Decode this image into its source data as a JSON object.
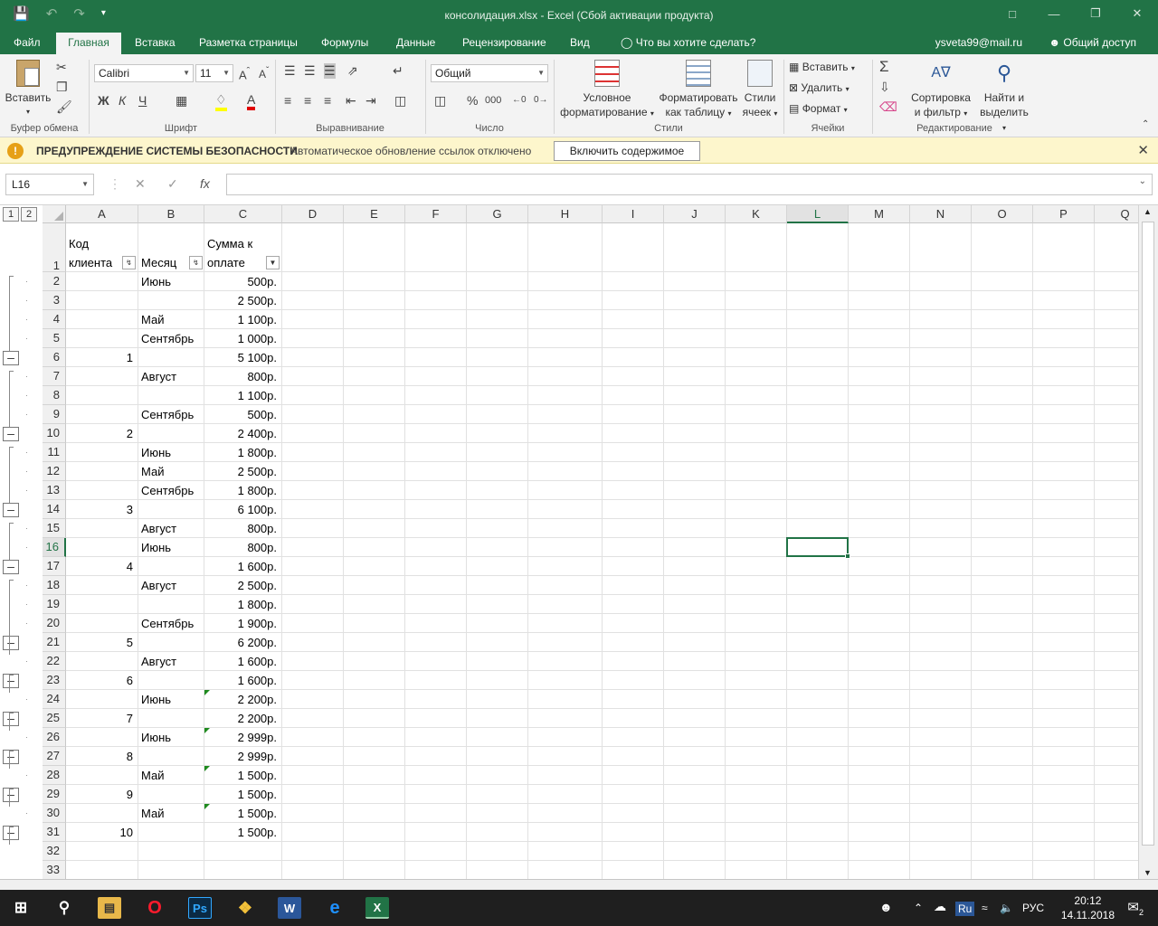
{
  "window": {
    "title": "консолидация.xlsx - Excel (Сбой активации продукта)"
  },
  "ribbon_tabs": [
    "Файл",
    "Главная",
    "Вставка",
    "Разметка страницы",
    "Формулы",
    "Данные",
    "Рецензирование",
    "Вид",
    "Что вы хотите сделать?"
  ],
  "user": {
    "email": "ysveta99@mail.ru",
    "share": "Общий доступ"
  },
  "ribbon": {
    "paste": "Вставить",
    "font_name": "Calibri",
    "font_size": "11",
    "number_format": "Общий",
    "cond_format_1": "Условное",
    "cond_format_2": "форматирование",
    "format_table_1": "Форматировать",
    "format_table_2": "как таблицу",
    "cell_styles_1": "Стили",
    "cell_styles_2": "ячеек",
    "insert": "Вставить",
    "delete": "Удалить",
    "format": "Формат",
    "sort_1": "Сортировка",
    "sort_2": "и фильтр",
    "find_1": "Найти и",
    "find_2": "выделить",
    "groups": [
      "Буфер обмена",
      "Шрифт",
      "Выравнивание",
      "Число",
      "Стили",
      "Ячейки",
      "Редактирование"
    ]
  },
  "security": {
    "title": "ПРЕДУПРЕЖДЕНИЕ СИСТЕМЫ БЕЗОПАСНОСТИ",
    "message": "Автоматическое обновление ссылок отключено",
    "button": "Включить содержимое"
  },
  "formula_bar": {
    "name_box": "L16",
    "value": ""
  },
  "columns": [
    "A",
    "B",
    "C",
    "D",
    "E",
    "F",
    "G",
    "H",
    "I",
    "J",
    "K",
    "L",
    "M",
    "N",
    "O",
    "P",
    "Q"
  ],
  "outline_levels": [
    "1",
    "2"
  ],
  "header_row": {
    "a1": "Код",
    "a2": "клиента",
    "b": "Месяц",
    "c1": "Сумма к",
    "c2": "оплате"
  },
  "rows": [
    {
      "n": "2",
      "a": "",
      "b": "Июнь",
      "c": "500р."
    },
    {
      "n": "3",
      "a": "",
      "b": "",
      "c": "2 500р."
    },
    {
      "n": "4",
      "a": "",
      "b": "Май",
      "c": "1 100р."
    },
    {
      "n": "5",
      "a": "",
      "b": "Сентябрь",
      "c": "1 000р."
    },
    {
      "n": "6",
      "a": "1",
      "b": "",
      "c": "5 100р."
    },
    {
      "n": "7",
      "a": "",
      "b": "Август",
      "c": "800р."
    },
    {
      "n": "8",
      "a": "",
      "b": "",
      "c": "1 100р."
    },
    {
      "n": "9",
      "a": "",
      "b": "Сентябрь",
      "c": "500р."
    },
    {
      "n": "10",
      "a": "2",
      "b": "",
      "c": "2 400р."
    },
    {
      "n": "11",
      "a": "",
      "b": "Июнь",
      "c": "1 800р."
    },
    {
      "n": "12",
      "a": "",
      "b": "Май",
      "c": "2 500р."
    },
    {
      "n": "13",
      "a": "",
      "b": "Сентябрь",
      "c": "1 800р."
    },
    {
      "n": "14",
      "a": "3",
      "b": "",
      "c": "6 100р."
    },
    {
      "n": "15",
      "a": "",
      "b": "Август",
      "c": "800р."
    },
    {
      "n": "16",
      "a": "",
      "b": "Июнь",
      "c": "800р."
    },
    {
      "n": "17",
      "a": "4",
      "b": "",
      "c": "1 600р."
    },
    {
      "n": "18",
      "a": "",
      "b": "Август",
      "c": "2 500р."
    },
    {
      "n": "19",
      "a": "",
      "b": "",
      "c": "1 800р."
    },
    {
      "n": "20",
      "a": "",
      "b": "Сентябрь",
      "c": "1 900р."
    },
    {
      "n": "21",
      "a": "5",
      "b": "",
      "c": "6 200р."
    },
    {
      "n": "22",
      "a": "",
      "b": "Август",
      "c": "1 600р."
    },
    {
      "n": "23",
      "a": "6",
      "b": "",
      "c": "1 600р."
    },
    {
      "n": "24",
      "a": "",
      "b": "Июнь",
      "c": "2 200р."
    },
    {
      "n": "25",
      "a": "7",
      "b": "",
      "c": "2 200р."
    },
    {
      "n": "26",
      "a": "",
      "b": "Июнь",
      "c": "2 999р."
    },
    {
      "n": "27",
      "a": "8",
      "b": "",
      "c": "2 999р."
    },
    {
      "n": "28",
      "a": "",
      "b": "Май",
      "c": "1 500р."
    },
    {
      "n": "29",
      "a": "9",
      "b": "",
      "c": "1 500р."
    },
    {
      "n": "30",
      "a": "",
      "b": "Май",
      "c": "1 500р."
    },
    {
      "n": "31",
      "a": "10",
      "b": "",
      "c": "1 500р."
    },
    {
      "n": "32",
      "a": "",
      "b": "",
      "c": ""
    },
    {
      "n": "33",
      "a": "",
      "b": "",
      "c": ""
    }
  ],
  "taskbar": {
    "lang": "РУС",
    "time": "20:12",
    "date": "14.11.2018",
    "notif": "2",
    "ps": "Ps",
    "ru": "Ru"
  }
}
